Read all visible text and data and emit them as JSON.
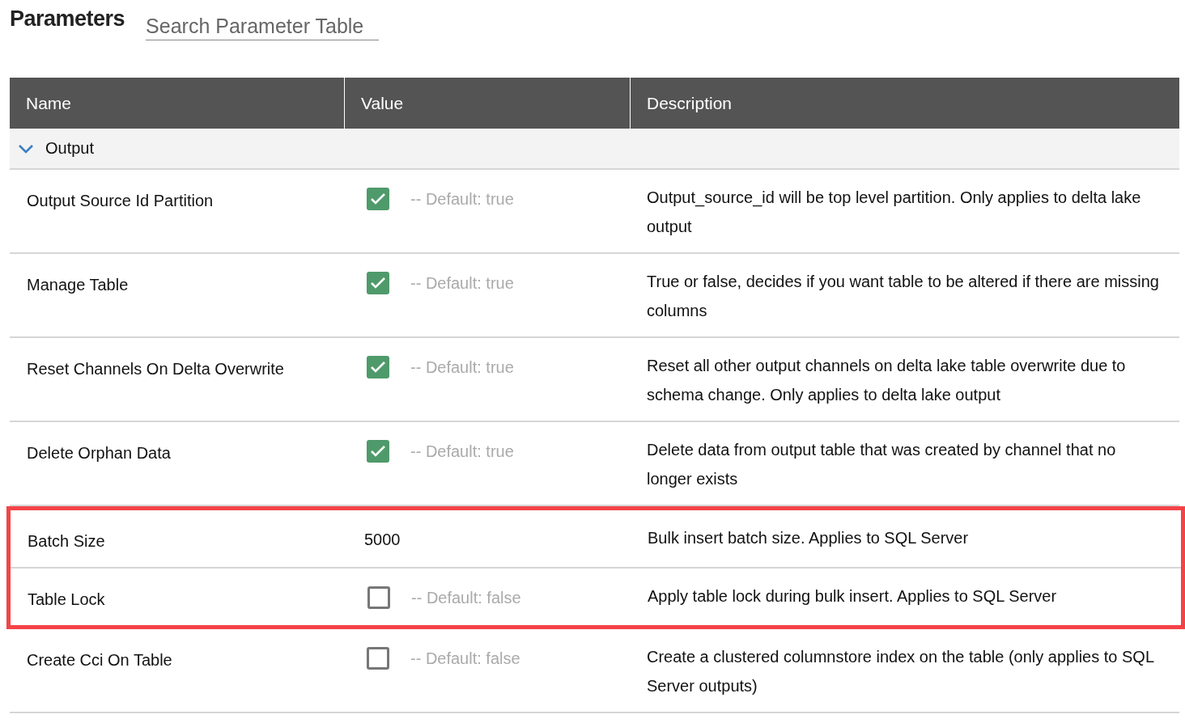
{
  "title": "Parameters",
  "search": {
    "placeholder": "Search Parameter Table"
  },
  "table": {
    "columns": [
      "Name",
      "Value",
      "Description"
    ],
    "groups": [
      {
        "label": "Output",
        "expanded": true,
        "rows": [
          {
            "name": "Output Source Id Partition",
            "kind": "checkbox",
            "checked": true,
            "default": "-- Default: true",
            "description": "Output_source_id will be top level partition. Only applies to delta lake output",
            "highlighted": false
          },
          {
            "name": "Manage Table",
            "kind": "checkbox",
            "checked": true,
            "default": "-- Default: true",
            "description": "True or false, decides if you want table to be altered if there are missing columns",
            "highlighted": false
          },
          {
            "name": "Reset Channels On Delta Overwrite",
            "kind": "checkbox",
            "checked": true,
            "default": "-- Default: true",
            "description": "Reset all other output channels on delta lake table overwrite due to schema change. Only applies to delta lake output",
            "highlighted": false
          },
          {
            "name": "Delete Orphan Data",
            "kind": "checkbox",
            "checked": true,
            "default": "-- Default: true",
            "description": "Delete data from output table that was created by channel that no longer exists",
            "highlighted": false
          },
          {
            "name": "Batch Size",
            "kind": "number",
            "value": "5000",
            "description": "Bulk insert batch size. Applies to SQL Server",
            "highlighted": true
          },
          {
            "name": "Table Lock",
            "kind": "checkbox",
            "checked": false,
            "default": "-- Default: false",
            "description": "Apply table lock during bulk insert. Applies to SQL Server",
            "highlighted": true
          },
          {
            "name": "Create Cci On Table",
            "kind": "checkbox",
            "checked": false,
            "default": "-- Default: false",
            "description": "Create a clustered columnstore index on the table (only applies to SQL Server outputs)",
            "highlighted": false
          }
        ]
      }
    ]
  }
}
